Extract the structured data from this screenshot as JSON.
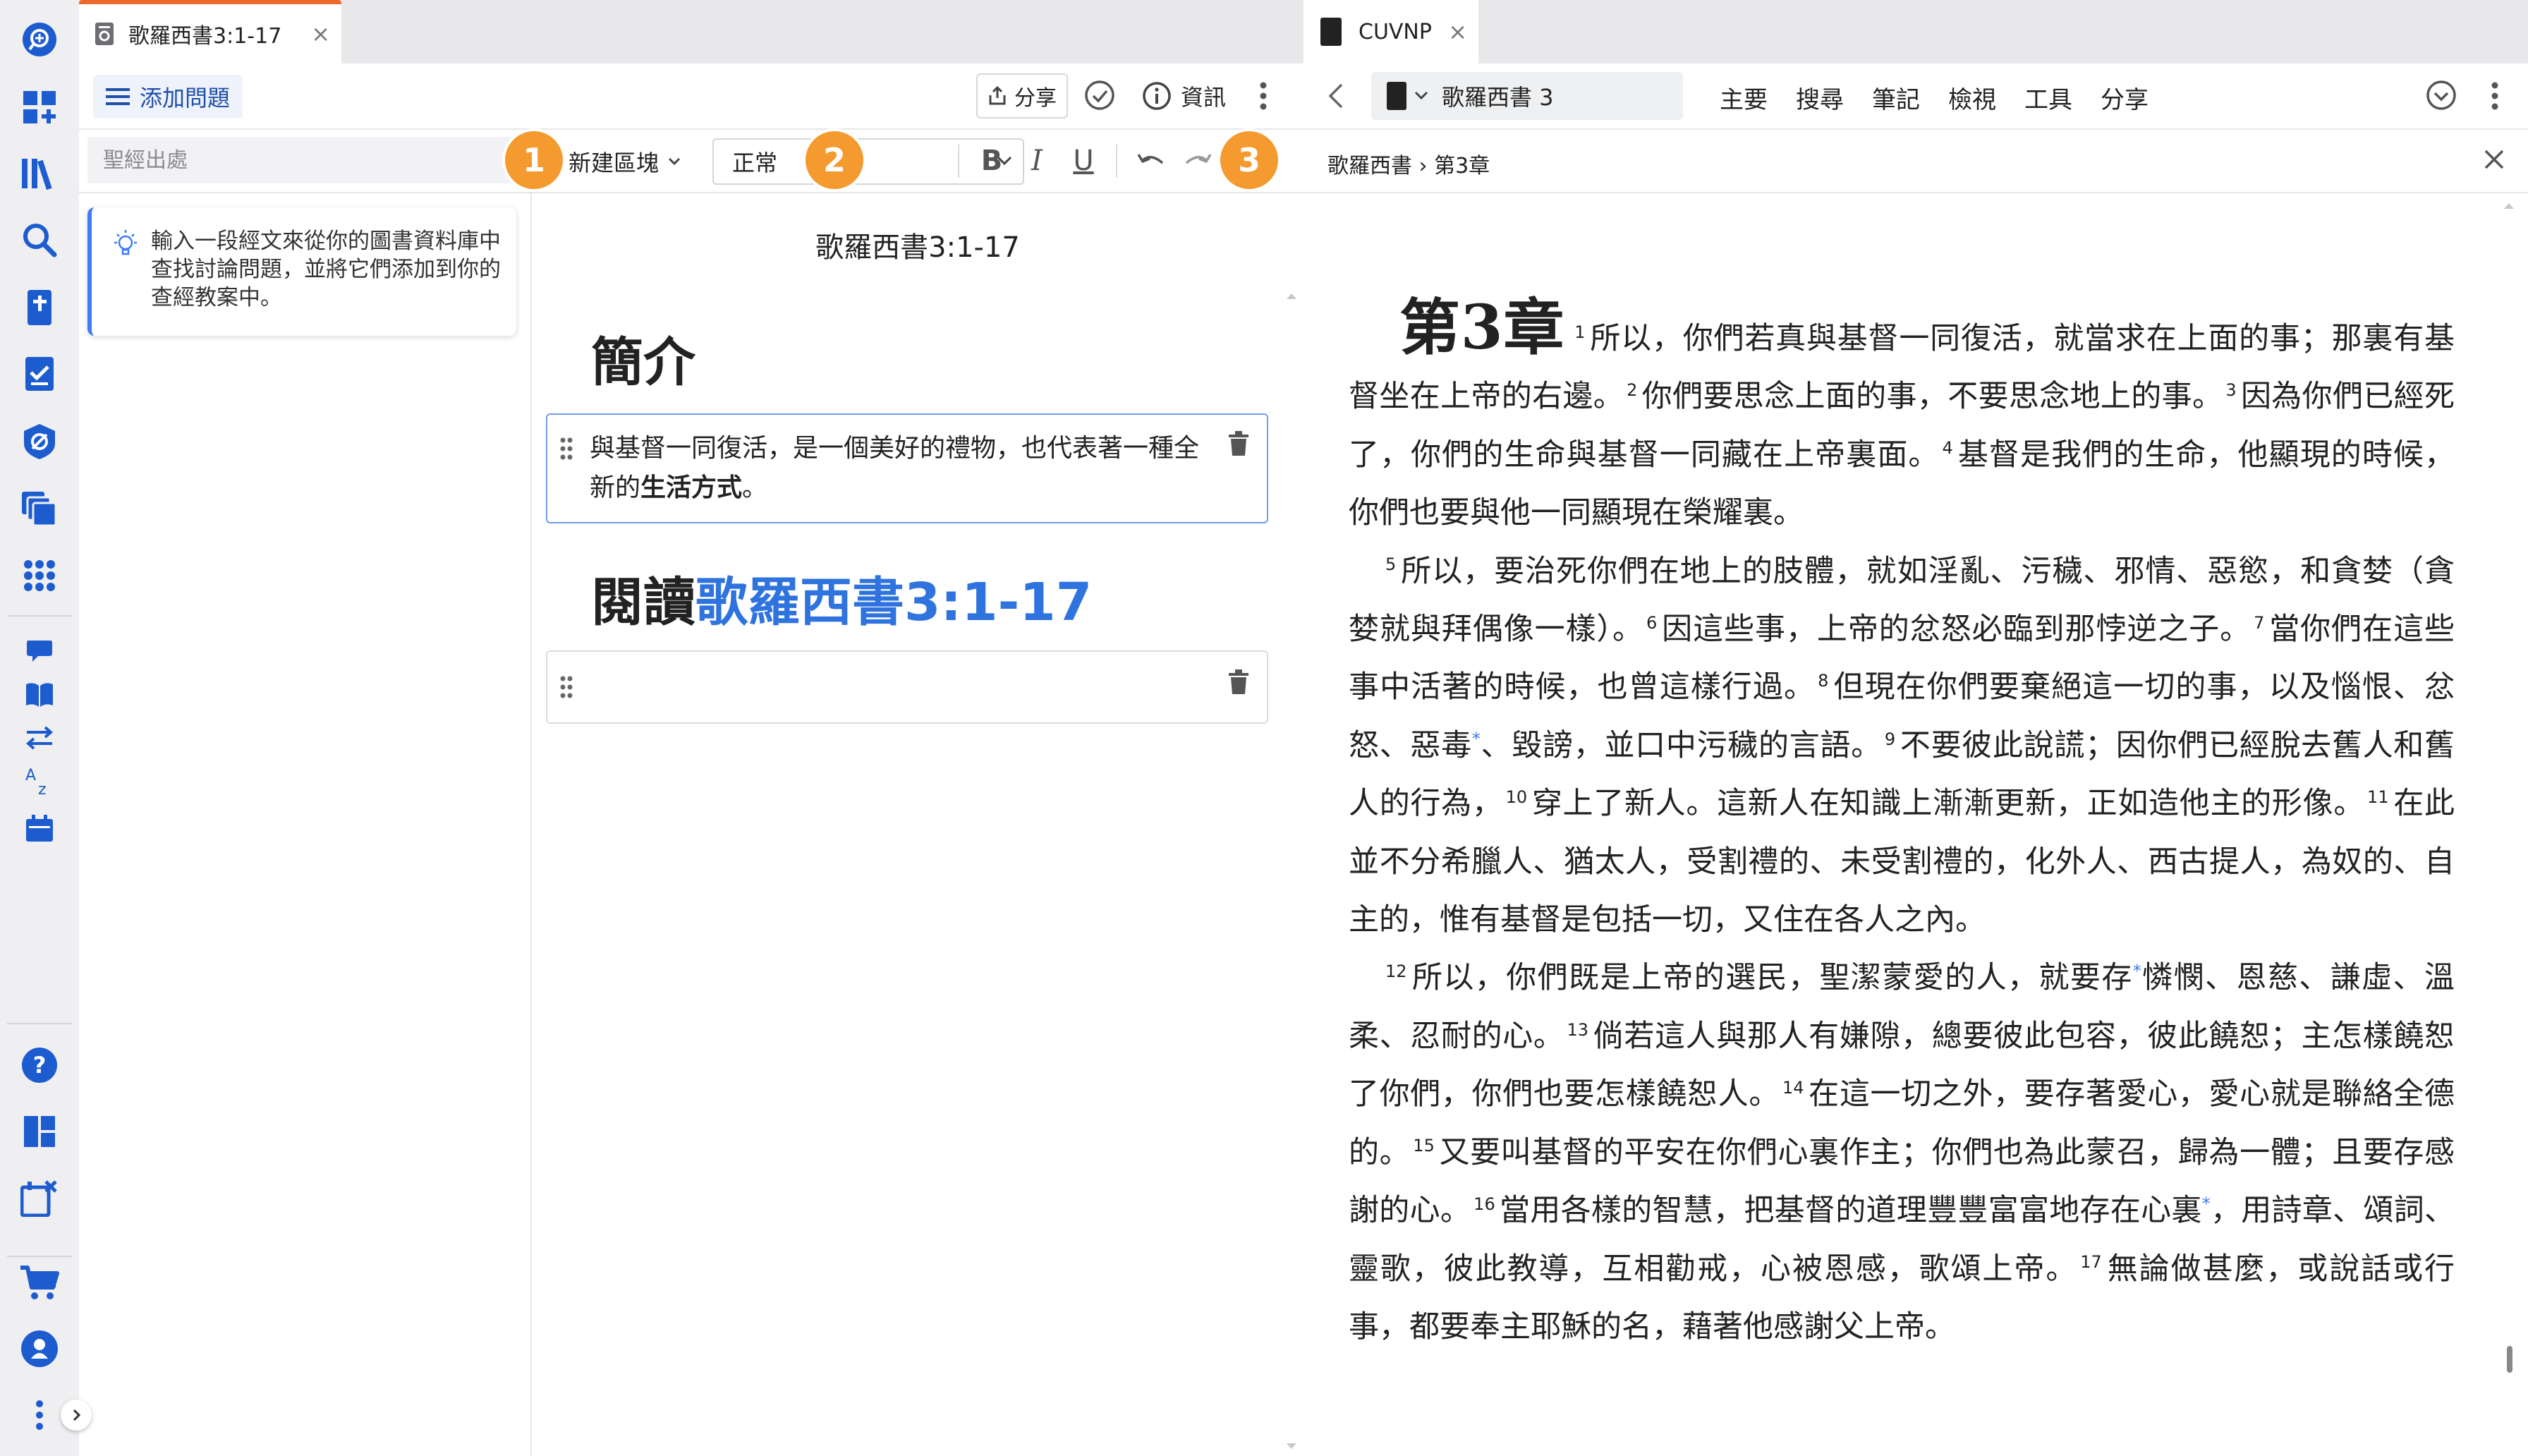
{
  "left_tab": {
    "title": "歌羅西書3:1-17",
    "close": "×"
  },
  "toolbar": {
    "add_question": "添加問題",
    "share": "分享",
    "info": "資訊"
  },
  "formatbar": {
    "ref_placeholder": "聖經出處",
    "new_block": "新建區塊",
    "style_value": "正常",
    "bold": "B",
    "italic": "I",
    "underline": "U",
    "badges": [
      "1",
      "2",
      "3"
    ]
  },
  "tip": {
    "text": "輸入一段經文來從你的圖書資料庫中查找討論問題，並將它們添加到你的查經教案中。"
  },
  "document": {
    "title": "歌羅西書3:1-17",
    "heading_intro": "簡介",
    "block_1_text": "與基督一同復活，是一個美好的禮物，也代表著一種全新的",
    "block_1_bold": "生活方式",
    "block_1_end": "。",
    "heading_read_prefix": "閱讀",
    "heading_read_link": "歌羅西書3:1-17"
  },
  "reader": {
    "tab_title": "CUVNP",
    "tab_close": "×",
    "book_selector": "歌羅西書 3",
    "menu": [
      "主要",
      "搜尋",
      "筆記",
      "檢視",
      "工具",
      "分享"
    ],
    "breadcrumb": "歌羅西書 › 第3章",
    "close": "×",
    "chapter_label_prefix": "第",
    "chapter_label_num": "3",
    "chapter_label_suffix": "章",
    "verses": [
      {
        "n": "1",
        "t": "所以，你們若真與基督一同復活，就當求在上面的事；那裏有基督坐在上帝的右邊。"
      },
      {
        "n": "2",
        "t": "你們要思念上面的事，不要思念地上的事。"
      },
      {
        "n": "3",
        "t": "因為你們已經死了，你們的生命與基督一同藏在上帝裏面。"
      },
      {
        "n": "4",
        "t": "基督是我們的生命，他顯現的時候，你們也要與他一同顯現在榮耀裏。"
      },
      {
        "n": "5",
        "t": "所以，要治死你們在地上的肢體，就如淫亂、污穢、邪情、惡慾，和貪婪（貪婪就與拜偶像一樣）。"
      },
      {
        "n": "6",
        "t": "因這些事，上帝的忿怒必臨到那悖逆之子。"
      },
      {
        "n": "7",
        "t": "當你們在這些事中活著的時候，也曾這樣行過。"
      },
      {
        "n": "8",
        "t": "但現在你們要棄絕這一切的事，以及惱恨、忿怒、惡毒",
        "fn": "*",
        "t2": "、毀謗，並口中污穢的言語。"
      },
      {
        "n": "9",
        "t": "不要彼此說謊；因你們已經脫去舊人和舊人的行為，"
      },
      {
        "n": "10",
        "t": "穿上了新人。這新人在知識上漸漸更新，正如造他主的形像。"
      },
      {
        "n": "11",
        "t": "在此並不分希臘人、猶太人，受割禮的、未受割禮的，化外人、西古提人，為奴的、自主的，惟有基督是包括一切，又住在各人之內。"
      },
      {
        "n": "12",
        "t": "所以，你們既是上帝的選民，聖潔蒙愛的人，就要存",
        "fn": "*",
        "t2": "憐憫、恩慈、謙虛、溫柔、忍耐的心。"
      },
      {
        "n": "13",
        "t": "倘若這人與那人有嫌隙，總要彼此包容，彼此饒恕；主怎樣饒恕了你們，你們也要怎樣饒恕人。"
      },
      {
        "n": "14",
        "t": "在這一切之外，要存著愛心，愛心就是聯絡全德的。"
      },
      {
        "n": "15",
        "t": "又要叫基督的平安在你們心裏作主；你們也為此蒙召，歸為一體；且要存感謝的心。"
      },
      {
        "n": "16",
        "t": "當用各樣的智慧，把基督的道理豐豐富富地存在心裏",
        "fn": "*",
        "t2": "，用詩章、頌詞、靈歌，彼此教導，互相勸戒，心被恩感，歌頌上帝。"
      },
      {
        "n": "17",
        "t": "無論做甚麼，或說話或行事，都要奉主耶穌的名，藉著他感謝父上帝。"
      }
    ]
  },
  "colors": {
    "accent_orange": "#ee6a2c",
    "badge_orange": "#f49a2e",
    "link_blue": "#2f73df",
    "rail_icon_blue": "#1c5ccf",
    "block_focus_blue": "#6f9eea"
  },
  "icons": {
    "rail": [
      "library-search-icon",
      "dashboard-add-icon",
      "library-icon",
      "search-icon",
      "bible-icon",
      "checklist-icon",
      "no-eye-icon",
      "layers-icon",
      "apps-grid-icon",
      "speech-bubble-icon",
      "open-book-icon",
      "swap-arrows-icon",
      "sort-az-icon",
      "calendar-icon",
      "help-icon",
      "layout-icon",
      "close-panels-icon",
      "cart-icon",
      "account-icon",
      "more-vertical-icon"
    ]
  }
}
